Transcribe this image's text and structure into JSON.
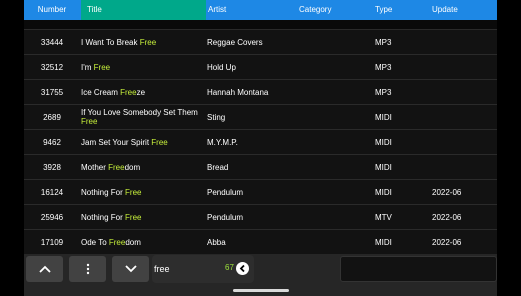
{
  "header": {
    "number": "Number",
    "title": "Title",
    "artist": "Artist",
    "category": "Category",
    "type": "Type",
    "update": "Update"
  },
  "rows": [
    {
      "number": "33444",
      "title_pre": "I Want To Break ",
      "title_hl": "Free",
      "title_post": "",
      "artist": "Reggae Covers",
      "category": "",
      "type": "MP3",
      "update": ""
    },
    {
      "number": "32512",
      "title_pre": "I'm ",
      "title_hl": "Free",
      "title_post": "",
      "artist": "Hold Up",
      "category": "",
      "type": "MP3",
      "update": ""
    },
    {
      "number": "31755",
      "title_pre": "Ice Cream ",
      "title_hl": "Free",
      "title_post": "ze",
      "artist": "Hannah Montana",
      "category": "",
      "type": "MP3",
      "update": ""
    },
    {
      "number": "2689",
      "title_pre": "If You Love Somebody Set Them ",
      "title_hl": "Free",
      "title_post": "",
      "artist": "Sting",
      "category": "",
      "type": "MIDI",
      "update": ""
    },
    {
      "number": "9462",
      "title_pre": "Jam Set Your Spirit ",
      "title_hl": "Free",
      "title_post": "",
      "artist": "M.Y.M.P.",
      "category": "",
      "type": "MIDI",
      "update": ""
    },
    {
      "number": "3928",
      "title_pre": "Mother ",
      "title_hl": "Free",
      "title_post": "dom",
      "artist": "Bread",
      "category": "",
      "type": "MIDI",
      "update": ""
    },
    {
      "number": "16124",
      "title_pre": "Nothing For ",
      "title_hl": "Free",
      "title_post": "",
      "artist": "Pendulum",
      "category": "",
      "type": "MIDI",
      "update": "2022-06"
    },
    {
      "number": "25946",
      "title_pre": "Nothing For ",
      "title_hl": "Free",
      "title_post": "",
      "artist": "Pendulum",
      "category": "",
      "type": "MTV",
      "update": "2022-06"
    },
    {
      "number": "17109",
      "title_pre": "Ode To ",
      "title_hl": "Free",
      "title_post": "dom",
      "artist": "Abba",
      "category": "",
      "type": "MIDI",
      "update": "2022-06"
    }
  ],
  "search": {
    "value": "free",
    "result_count": "67"
  },
  "icons": {
    "up": "chevron-up-icon",
    "more": "more-vertical-icon",
    "down": "chevron-down-icon",
    "clear": "back-arrow-icon"
  },
  "colors": {
    "header_blue": "#1e88e5",
    "title_header_teal": "#00a88a",
    "highlight": "#c6ef3b",
    "count_green": "#9be33a"
  }
}
